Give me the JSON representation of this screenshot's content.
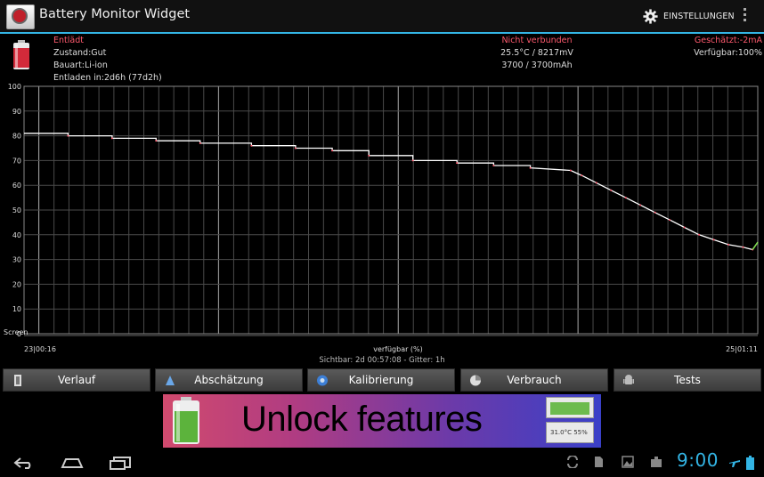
{
  "app": {
    "title": "Battery Monitor Widget",
    "settings_label": "EINSTELLUNGEN",
    "accent_color": "#33b5e5"
  },
  "info": {
    "status": "Entlädt",
    "condition": "Zustand:Gut",
    "type": "Bauart:Li-ion",
    "discharge": "Entladen in:2d6h (77d2h)",
    "connection": "Nicht verbunden",
    "temp_voltage": "25.5°C / 8217mV",
    "capacity": "3700 / 3700mAh",
    "estimate": "Geschätzt:-2mA",
    "available": "Verfügbar:100%"
  },
  "chart_data": {
    "type": "line",
    "x_start": "23|00:16",
    "x_end": "25|01:11",
    "xlabel": "verfügbar (%)",
    "screen_label": "Screen",
    "ylim": [
      0,
      100
    ],
    "y_ticks": [
      0,
      10,
      20,
      30,
      40,
      50,
      60,
      70,
      80,
      90,
      100
    ],
    "grid": true,
    "series": [
      {
        "x": [
          0,
          0.06,
          0.06,
          0.12,
          0.12,
          0.18,
          0.18,
          0.24,
          0.24,
          0.31,
          0.31,
          0.37,
          0.37,
          0.42,
          0.42,
          0.47,
          0.47,
          0.53,
          0.53,
          0.59,
          0.59,
          0.64,
          0.64,
          0.69,
          0.69,
          0.745,
          0.76,
          0.78,
          0.8,
          0.82,
          0.84,
          0.86,
          0.88,
          0.9,
          0.92,
          0.94,
          0.96,
          0.98,
          0.993,
          1.0
        ],
        "y": [
          81,
          81,
          80,
          80,
          79,
          79,
          78,
          78,
          77,
          77,
          76,
          76,
          75,
          75,
          74,
          74,
          72,
          72,
          70,
          70,
          69,
          69,
          68,
          68,
          67,
          66,
          64,
          61,
          58,
          55,
          52,
          49,
          46,
          43,
          40,
          38,
          36,
          35,
          34,
          37
        ]
      }
    ]
  },
  "chart_footer": "Sichtbar: 2d 00:57:08 - Gitter: 1h",
  "tabs": [
    {
      "label": "Verlauf",
      "icon": "history-icon"
    },
    {
      "label": "Abschätzung",
      "icon": "estimate-icon"
    },
    {
      "label": "Kalibrierung",
      "icon": "calibration-icon"
    },
    {
      "label": "Verbrauch",
      "icon": "usage-icon"
    },
    {
      "label": "Tests",
      "icon": "android-icon"
    }
  ],
  "banner": {
    "text": "Unlock features",
    "mini_widget_text": "31.0°C  55%"
  },
  "system": {
    "clock": "9:00"
  }
}
